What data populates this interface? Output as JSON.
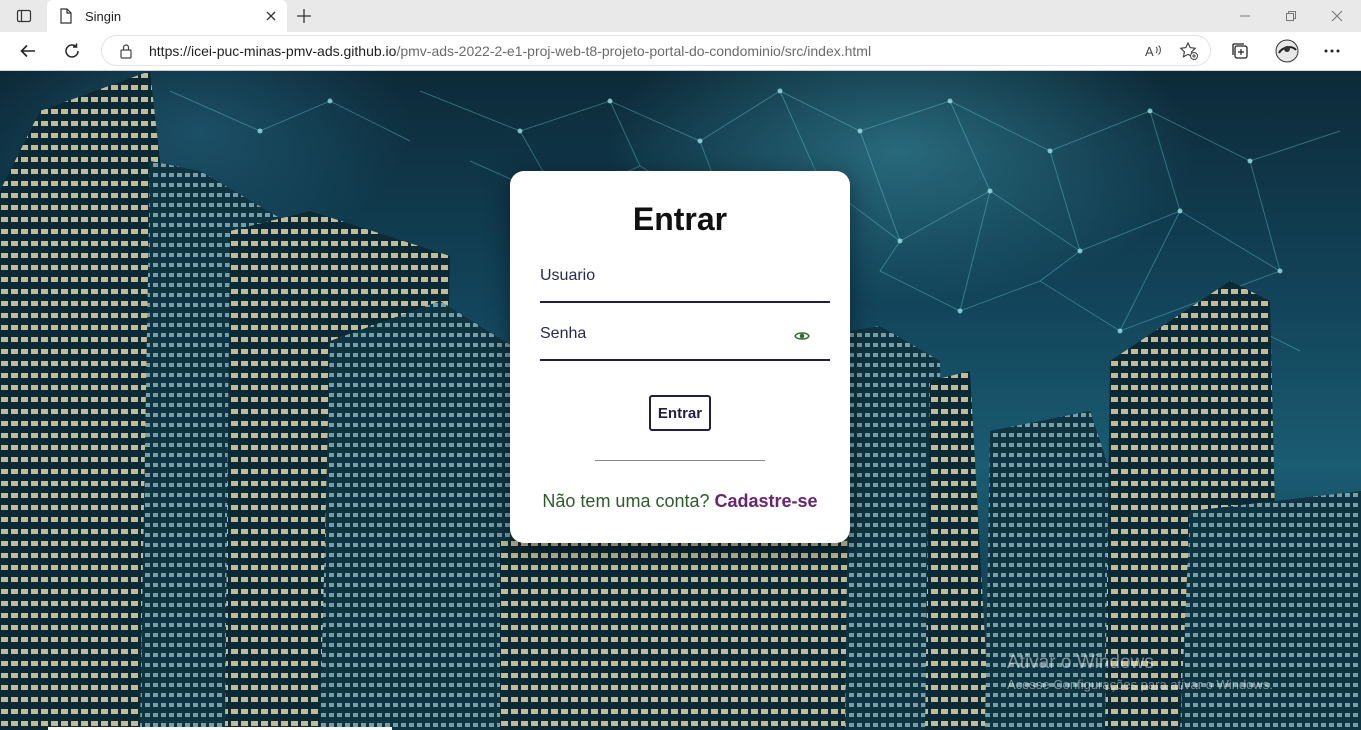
{
  "browser": {
    "tab_title": "Singin",
    "url_host": "https://icei-puc-minas-pmv-ads.github.io",
    "url_path": "/pmv-ads-2022-2-e1-proj-web-t8-projeto-portal-do-condominio/src/index.html",
    "icons": [
      "sidebar-toggle-icon",
      "page-icon",
      "close-icon",
      "plus-icon",
      "minimize-icon",
      "restore-icon",
      "close-window-icon",
      "back-arrow-icon",
      "refresh-icon",
      "lock-icon",
      "read-aloud-icon",
      "favorites-add-icon",
      "collections-icon",
      "profile-avatar-icon",
      "more-menu-icon"
    ]
  },
  "login": {
    "title": "Entrar",
    "username_placeholder": "Usuario",
    "password_placeholder": "Senha",
    "submit_label": "Entrar",
    "signup_prompt": "Não tem uma conta?",
    "signup_link": "Cadastre-se",
    "eye_icon": "eye-icon"
  },
  "watermark": {
    "line1": "Ativar o Windows",
    "line2": "Acesse Configurações para ativar o Windows."
  },
  "colors": {
    "accent_navy": "#231d47",
    "link_purple": "#6a2470",
    "prompt_green": "#2d5a2d",
    "eye_green": "#2e6b2e"
  }
}
